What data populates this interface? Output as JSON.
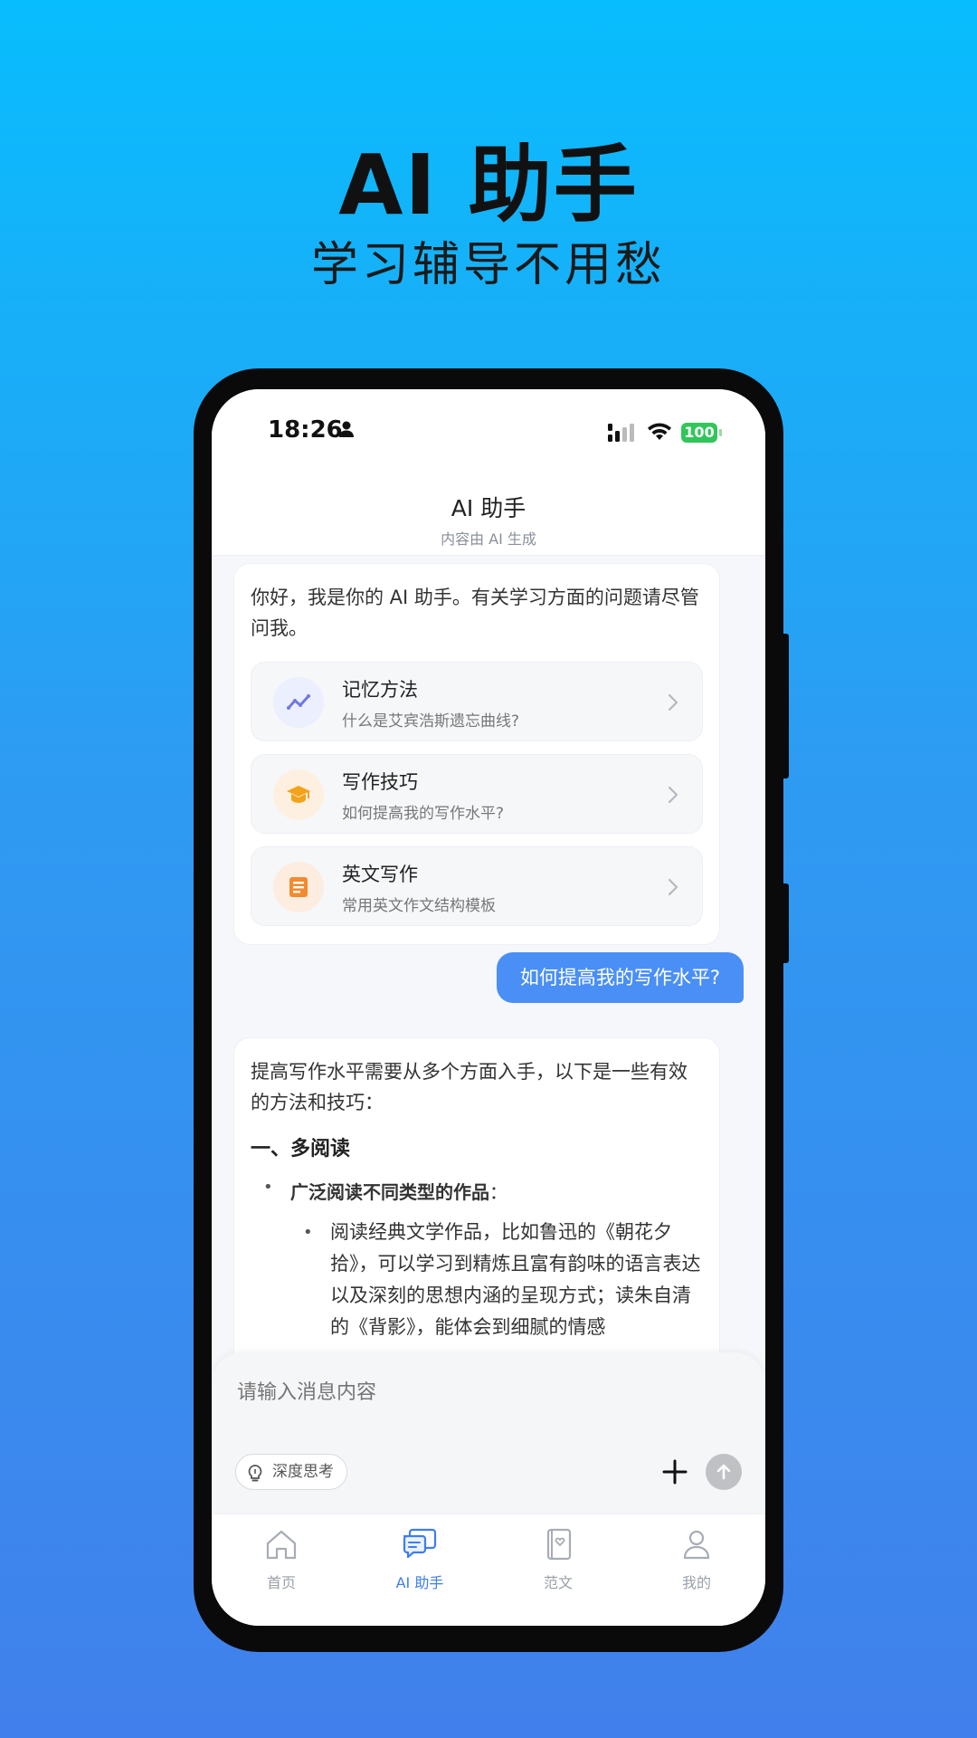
{
  "hero": {
    "title": "AI 助手",
    "subtitle": "学习辅导不用愁"
  },
  "status_bar": {
    "time": "18:26",
    "battery": "100"
  },
  "header": {
    "title": "AI 助手",
    "subtitle": "内容由 AI 生成"
  },
  "greeting": {
    "message": "你好，我是你的 AI 助手。有关学习方面的问题请尽管问我。",
    "suggestions": [
      {
        "title": "记忆方法",
        "desc": "什么是艾宾浩斯遗忘曲线?",
        "icon": "trend-line-icon",
        "icon_bg": "#eceffd",
        "icon_color": "#6f79e0"
      },
      {
        "title": "写作技巧",
        "desc": "如何提高我的写作水平?",
        "icon": "graduation-cap-icon",
        "icon_bg": "#fdf0e0",
        "icon_color": "#f2a31b"
      },
      {
        "title": "英文写作",
        "desc": "常用英文作文结构模板",
        "icon": "document-icon",
        "icon_bg": "#fdece0",
        "icon_color": "#f28a2e"
      }
    ]
  },
  "user_message": "如何提高我的写作水平?",
  "answer": {
    "intro": "提高写作水平需要从多个方面入手，以下是一些有效的方法和技巧：",
    "heading": "一、多阅读",
    "bullet_bold": "广泛阅读不同类型的作品",
    "bullet_suffix": "：",
    "sub_bullet": "阅读经典文学作品，比如鲁迅的《朝花夕拾》，可以学习到精炼且富有韵味的语言表达以及深刻的思想内涵的呈现方式；读朱自清的《背影》，能体会到细腻的情感"
  },
  "input": {
    "placeholder": "请输入消息内容",
    "deep_think_label": "深度思考"
  },
  "tabs": [
    {
      "label": "首页",
      "icon": "home-icon",
      "active": false
    },
    {
      "label": "AI 助手",
      "icon": "chat-icon",
      "active": true
    },
    {
      "label": "范文",
      "icon": "book-icon",
      "active": false
    },
    {
      "label": "我的",
      "icon": "user-icon",
      "active": false
    }
  ],
  "colors": {
    "accent": "#3d7df0",
    "user_bubble": "#4a8ff5",
    "battery_green": "#31c65a"
  }
}
